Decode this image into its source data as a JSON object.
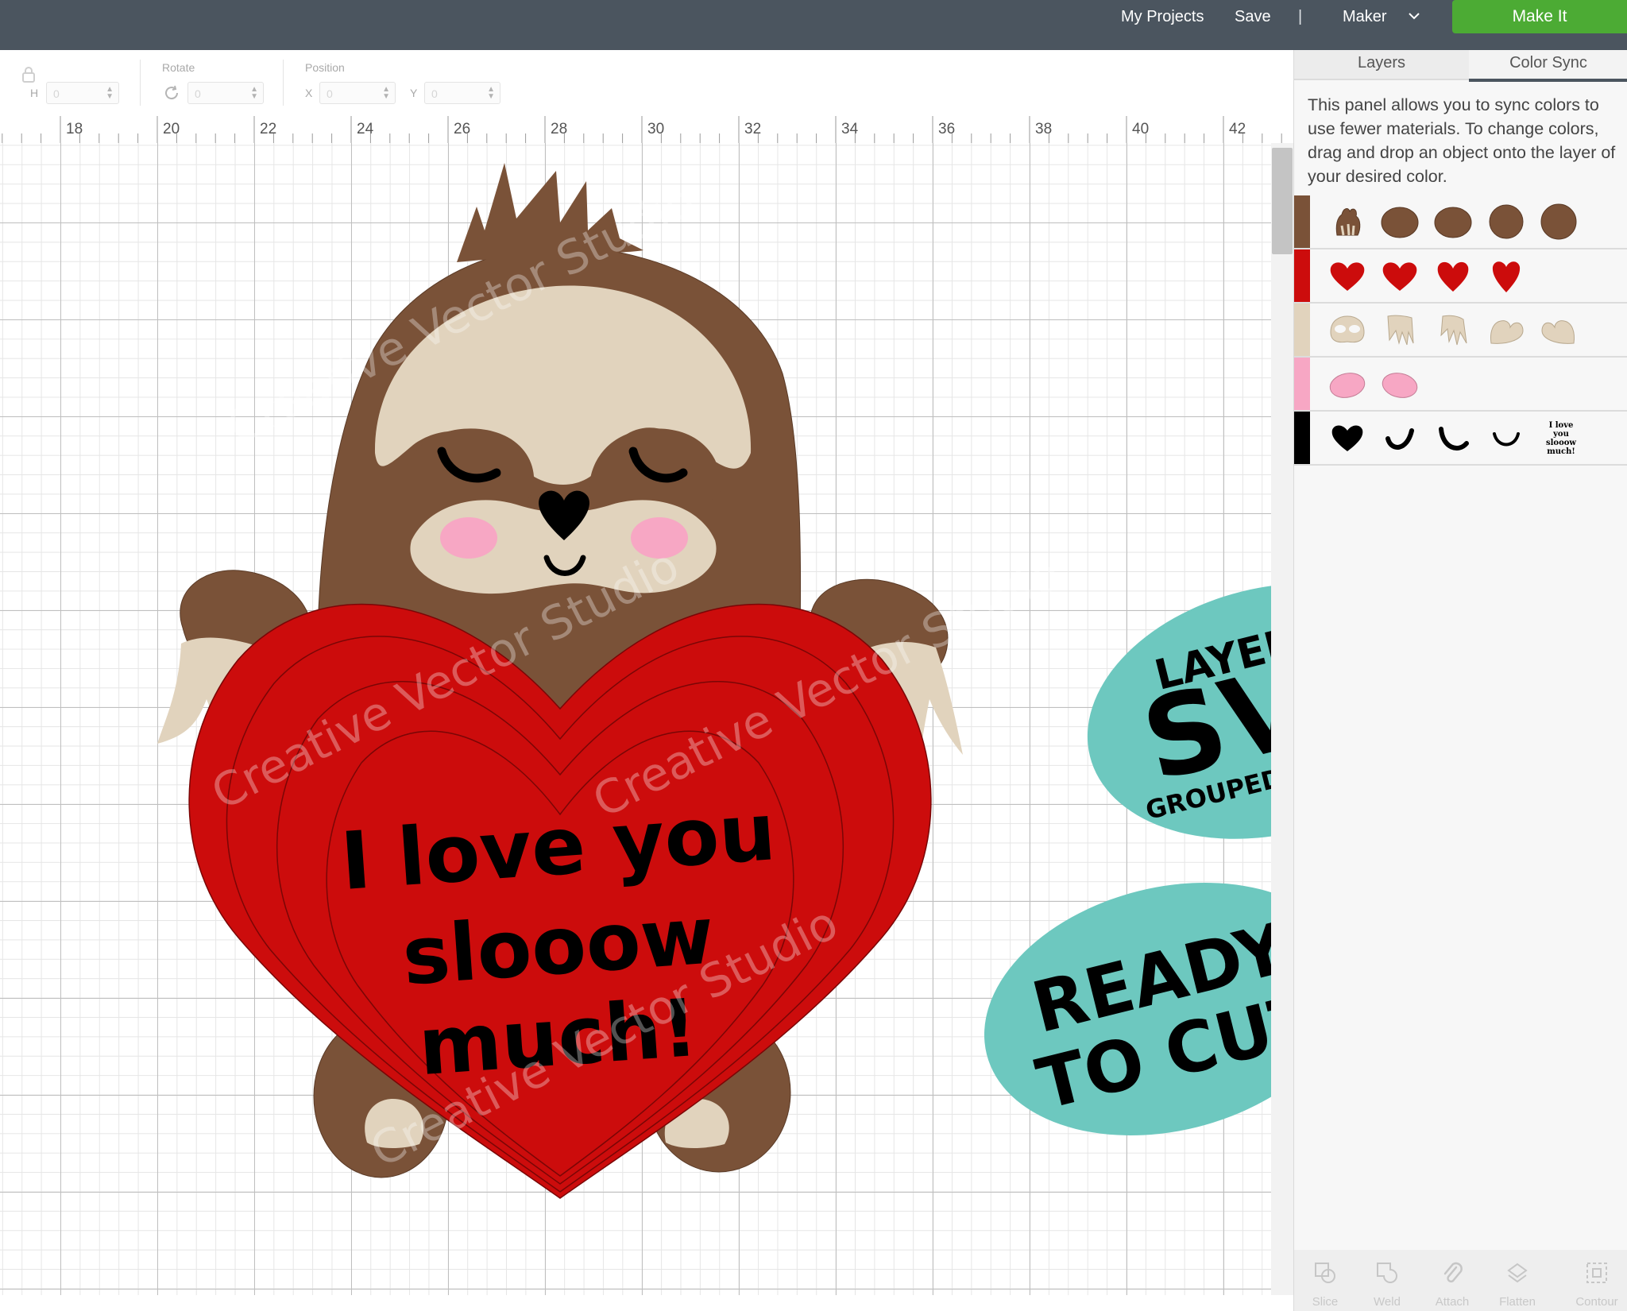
{
  "header": {
    "my_projects": "My Projects",
    "save": "Save",
    "separator": "|",
    "machine": "Maker",
    "make_it": "Make It"
  },
  "edit_toolbar": {
    "size_h_label": "H",
    "size_h_value": "0",
    "rotate_label": "Rotate",
    "rotate_value": "0",
    "position_label": "Position",
    "x_label": "X",
    "x_value": "0",
    "y_label": "Y",
    "y_value": "0"
  },
  "ruler": {
    "labels": [
      "18",
      "20",
      "22",
      "24",
      "26",
      "28",
      "30",
      "32",
      "34",
      "36",
      "38",
      "40",
      "42"
    ]
  },
  "design": {
    "heart_text_line1": "I love you",
    "heart_text_line2": "slooow",
    "heart_text_line3": "much!",
    "watermark": "Creative Vector Studio"
  },
  "badges": {
    "layered": "LAYERED",
    "svg": "SVG",
    "grouped": "GROUPED BY COLOR",
    "ready": "READY",
    "to_cut": "TO CUT",
    "badge_color": "#6dc8bf"
  },
  "panel": {
    "tabs": [
      "Layers",
      "Color Sync"
    ],
    "active_tab": "Color Sync",
    "description": "This panel allows you to sync colors to use fewer materials. To change colors, drag and drop an object onto the layer of your desired color.",
    "color_rows": [
      {
        "color": "#7a5238",
        "items": [
          "hand",
          "blob",
          "blob",
          "blob",
          "blob"
        ]
      },
      {
        "color": "#cc0c0c",
        "items": [
          "heart",
          "heart",
          "heart",
          "heart"
        ]
      },
      {
        "color": "#e1d3bd",
        "items": [
          "face",
          "claws",
          "claws",
          "heart",
          "heart"
        ]
      },
      {
        "color": "#f7a7c4",
        "items": [
          "cheek",
          "cheek"
        ]
      },
      {
        "color": "#000000",
        "items": [
          "nose",
          "eye",
          "eye",
          "smile",
          "text"
        ]
      }
    ],
    "text_thumb": "I love you slooow much!",
    "tools": [
      "Slice",
      "Weld",
      "Attach",
      "Flatten",
      "Contour"
    ]
  },
  "colors": {
    "topbar": "#4b555f",
    "make_it": "#4cab34",
    "sloth_brown": "#7a5238",
    "sloth_tan": "#e1d3bd",
    "heart_red": "#cc0c0c",
    "cheek_pink": "#f7a7c4"
  }
}
